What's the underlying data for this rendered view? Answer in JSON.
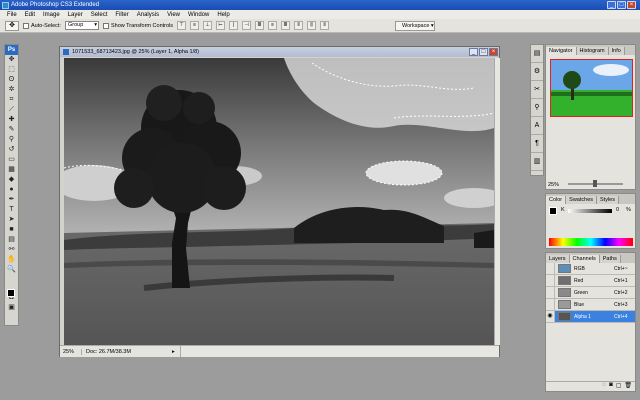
{
  "app": {
    "title": "Adobe Photoshop CS3 Extended",
    "icon": "Ps"
  },
  "menu": [
    "File",
    "Edit",
    "Image",
    "Layer",
    "Select",
    "Filter",
    "Analysis",
    "View",
    "Window",
    "Help"
  ],
  "options": {
    "auto_select_label": "Auto-Select:",
    "auto_select_value": "Group",
    "transform_label": "Show Transform Controls",
    "workspace_label": "Workspace ▾"
  },
  "document": {
    "title": "1071533_68713423.jpg @ 25% (Layer 1, Alpha 1/8)",
    "zoom": "25%",
    "doc_size": "Doc: 26.7M/38.3M"
  },
  "panels": {
    "navigator": {
      "tabs": [
        "Navigator",
        "Histogram",
        "Info"
      ],
      "zoom": "25%"
    },
    "color": {
      "tabs": [
        "Color",
        "Swatches",
        "Styles"
      ],
      "k_label": "K",
      "k_value": "0",
      "k_unit": "%"
    },
    "channels": {
      "tabs": [
        "Layers",
        "Channels",
        "Paths"
      ],
      "rows": [
        {
          "name": "RGB",
          "key": "Ctrl+~"
        },
        {
          "name": "Red",
          "key": "Ctrl+1"
        },
        {
          "name": "Green",
          "key": "Ctrl+2"
        },
        {
          "name": "Blue",
          "key": "Ctrl+3"
        },
        {
          "name": "Alpha 1",
          "key": "Ctrl+4"
        }
      ]
    }
  },
  "colors": {
    "title_blue": "#1b4db3",
    "selection_blue": "#3b82e0",
    "nav_frame": "#dd2222"
  }
}
